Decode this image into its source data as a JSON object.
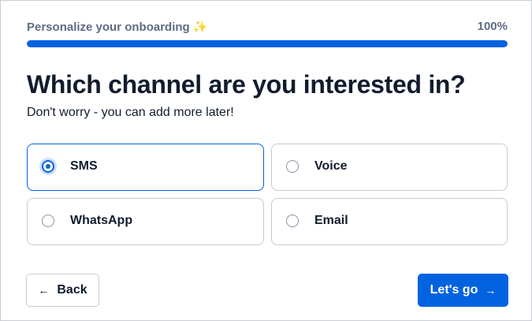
{
  "header": {
    "title": "Personalize your onboarding",
    "title_icon": "sparkles-icon",
    "progress_text": "100%",
    "progress_fraction": 1.0,
    "accent_color": "#0263e0"
  },
  "main": {
    "heading": "Which channel are you interested in?",
    "subheading": "Don't worry - you can add more later!",
    "options": [
      {
        "label": "SMS",
        "selected": true
      },
      {
        "label": "Voice",
        "selected": false
      },
      {
        "label": "WhatsApp",
        "selected": false
      },
      {
        "label": "Email",
        "selected": false
      }
    ]
  },
  "footer": {
    "back_label": "Back",
    "back_icon": "arrow-left-icon",
    "next_label": "Let's go",
    "next_icon": "arrow-right-icon"
  }
}
